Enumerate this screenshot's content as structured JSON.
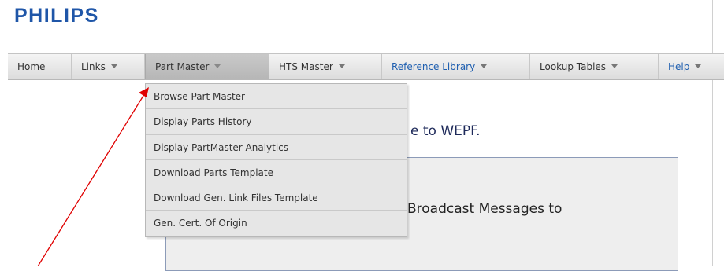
{
  "brand": {
    "logo": "PHILIPS",
    "color": "#1f56a8"
  },
  "nav": [
    {
      "label": "Home",
      "dropdown": false
    },
    {
      "label": "Links",
      "dropdown": true
    },
    {
      "label": "Part Master",
      "dropdown": true,
      "active": true
    },
    {
      "label": "HTS Master",
      "dropdown": true
    },
    {
      "label": "Reference Library",
      "dropdown": true
    },
    {
      "label": "Lookup Tables",
      "dropdown": true
    },
    {
      "label": "Help",
      "dropdown": true
    }
  ],
  "part_master_menu": [
    "Browse Part Master",
    "Display Parts History",
    "Display PartMaster Analytics",
    "Download Parts Template",
    "Download Gen. Link Files Template",
    "Gen. Cert. Of Origin"
  ],
  "main": {
    "welcome_visible": "e to WEPF.",
    "broadcast_visible": "Broadcast Messages to"
  },
  "annotation": {
    "arrow_color": "#e00000"
  }
}
